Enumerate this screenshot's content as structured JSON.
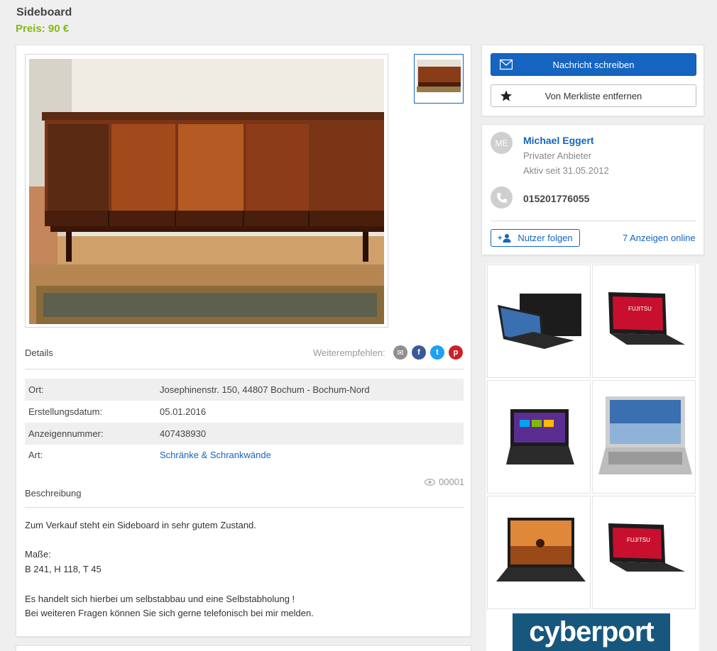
{
  "listing": {
    "title": "Sideboard",
    "price": "Preis: 90 €"
  },
  "details": {
    "heading": "Details",
    "share_label": "Weiterempfehlen:",
    "rows": [
      {
        "key": "Ort:",
        "value": "Josephinenstr. 150, 44807 Bochum - Bochum-Nord"
      },
      {
        "key": "Erstellungsdatum:",
        "value": "05.01.2016"
      },
      {
        "key": "Anzeigennummer:",
        "value": "407438930"
      },
      {
        "key": "Art:",
        "value": "Schränke & Schrankwände"
      }
    ],
    "views": "00001"
  },
  "description": {
    "heading": "Beschreibung",
    "lines": [
      "Zum Verkauf steht ein Sideboard in sehr gutem Zustand.",
      "Maße:",
      "B 241, H 118, T 45",
      "Es handelt sich hierbei um selbstabbau und eine Selbstabholung !",
      "Bei weiteren Fragen können Sie sich gerne telefonisch bei mir melden."
    ]
  },
  "actions": {
    "message_label": "Nachricht schreiben",
    "watchlist_label": "Von Merkliste entfernen"
  },
  "seller": {
    "initials": "ME",
    "name": "Michael Eggert",
    "type": "Privater Anbieter",
    "since": "Aktiv seit 31.05.2012",
    "phone": "015201776055",
    "follow_label": "Nutzer folgen",
    "ads_online": "7 Anzeigen online"
  },
  "ad": {
    "banner_text": "cyberport"
  },
  "colors": {
    "accent_blue": "#1565c0",
    "price_green": "#86b817"
  }
}
